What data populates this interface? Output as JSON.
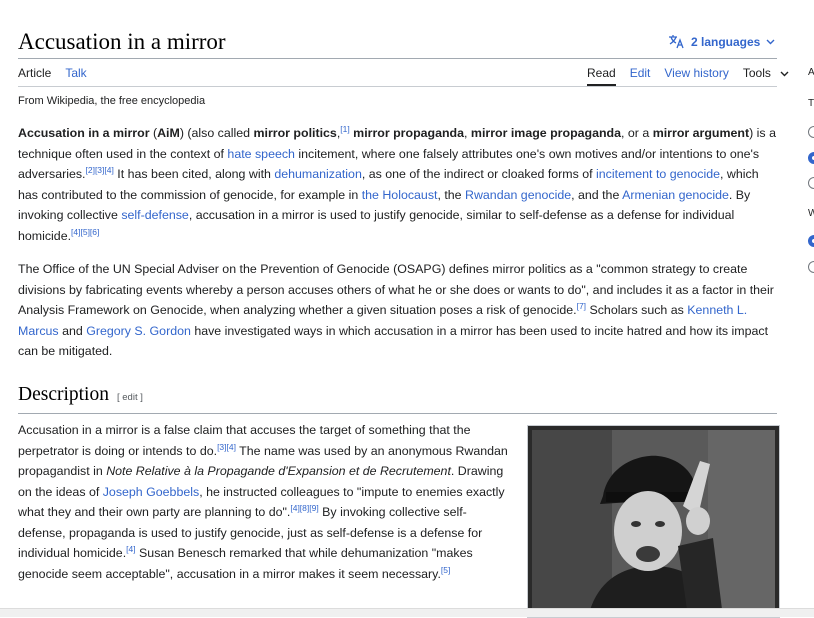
{
  "page": {
    "title": "Accusation in a mirror",
    "languages": "2 languages",
    "tabs_left": [
      "Article",
      "Talk"
    ],
    "tabs_right": [
      "Read",
      "Edit",
      "View history",
      "Tools"
    ],
    "from": "From Wikipedia, the free encyclopedia"
  },
  "section": {
    "heading": "Description",
    "edit": "[ edit ]"
  },
  "sidebar": {
    "labels": [
      "A",
      "T",
      "W"
    ]
  },
  "colors": {
    "link": "#3366cc",
    "text": "#202122",
    "rule": "#a2a9b1"
  },
  "icons": [
    "translate-icon",
    "chevron-down-icon",
    "portrait-image"
  ]
}
